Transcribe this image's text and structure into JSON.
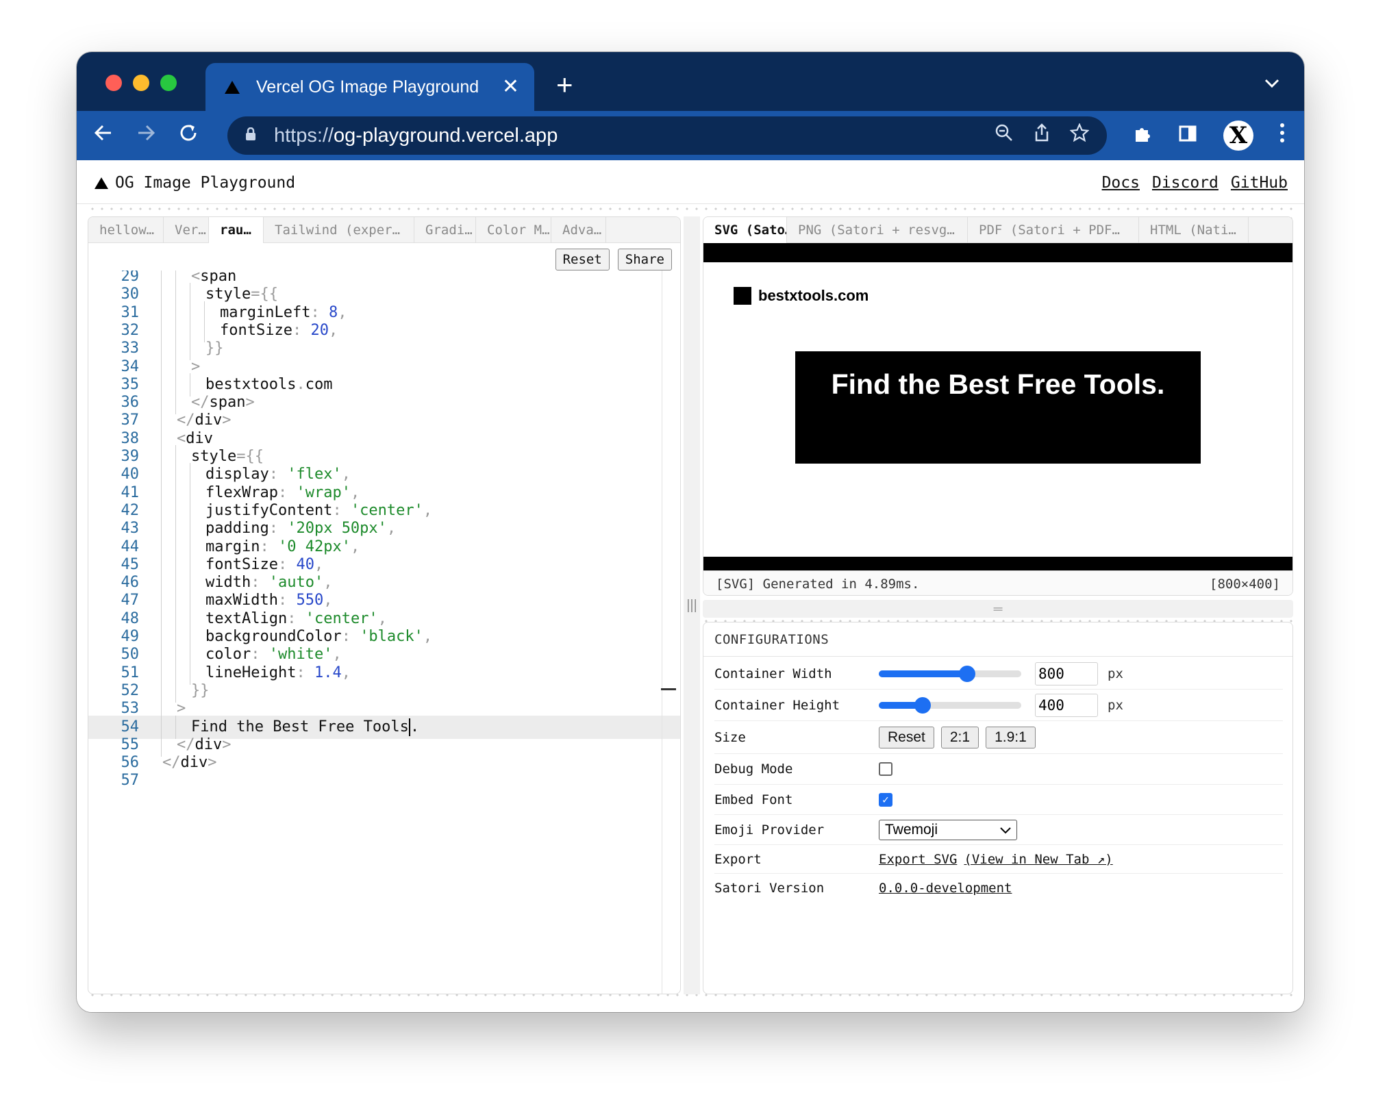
{
  "browser": {
    "tab_title": "Vercel OG Image Playground",
    "tab_close": "✕",
    "new_tab": "+",
    "url_scheme": "https://",
    "url_host": "og-playground.vercel.app",
    "avatar_letter": "X"
  },
  "app": {
    "brand": "OG Image Playground",
    "links": [
      "Docs",
      "Discord",
      "GitHub"
    ]
  },
  "editor": {
    "file_tabs": [
      {
        "label": "hellow…",
        "width": 110
      },
      {
        "label": "Ver…",
        "width": 66
      },
      {
        "label": "rau…",
        "width": 80,
        "active": true
      },
      {
        "label": "Tailwind (exper…",
        "width": 220
      },
      {
        "label": "Gradi…",
        "width": 90
      },
      {
        "label": "Color M…",
        "width": 110
      },
      {
        "label": "Adva…",
        "width": 80
      }
    ],
    "reset_label": "Reset",
    "share_label": "Share",
    "current_line": 54,
    "lines": [
      {
        "n": 29,
        "indent": 2,
        "tokens": [
          [
            "p",
            "<"
          ],
          [
            "t",
            "span"
          ]
        ]
      },
      {
        "n": 30,
        "indent": 3,
        "tokens": [
          [
            "t",
            "style"
          ],
          [
            "p",
            "={{"
          ]
        ]
      },
      {
        "n": 31,
        "indent": 4,
        "tokens": [
          [
            "t",
            "marginLeft"
          ],
          [
            "p",
            ": "
          ],
          [
            "n",
            "8"
          ],
          [
            "p",
            ","
          ]
        ]
      },
      {
        "n": 32,
        "indent": 4,
        "tokens": [
          [
            "t",
            "fontSize"
          ],
          [
            "p",
            ": "
          ],
          [
            "n",
            "20"
          ],
          [
            "p",
            ","
          ]
        ]
      },
      {
        "n": 33,
        "indent": 3,
        "tokens": [
          [
            "p",
            "}}"
          ]
        ]
      },
      {
        "n": 34,
        "indent": 2,
        "tokens": [
          [
            "p",
            ">"
          ]
        ]
      },
      {
        "n": 35,
        "indent": 3,
        "tokens": [
          [
            "t",
            "bestxtools"
          ],
          [
            "p",
            "."
          ],
          [
            "t",
            "com"
          ]
        ]
      },
      {
        "n": 36,
        "indent": 2,
        "tokens": [
          [
            "p",
            "</"
          ],
          [
            "t",
            "span"
          ],
          [
            "p",
            ">"
          ]
        ]
      },
      {
        "n": 37,
        "indent": 1,
        "tokens": [
          [
            "p",
            "</"
          ],
          [
            "t",
            "div"
          ],
          [
            "p",
            ">"
          ]
        ]
      },
      {
        "n": 38,
        "indent": 1,
        "tokens": [
          [
            "p",
            "<"
          ],
          [
            "t",
            "div"
          ]
        ]
      },
      {
        "n": 39,
        "indent": 2,
        "tokens": [
          [
            "t",
            "style"
          ],
          [
            "p",
            "={{"
          ]
        ]
      },
      {
        "n": 40,
        "indent": 3,
        "tokens": [
          [
            "t",
            "display"
          ],
          [
            "p",
            ": "
          ],
          [
            "s",
            "'flex'"
          ],
          [
            "p",
            ","
          ]
        ]
      },
      {
        "n": 41,
        "indent": 3,
        "tokens": [
          [
            "t",
            "flexWrap"
          ],
          [
            "p",
            ": "
          ],
          [
            "s",
            "'wrap'"
          ],
          [
            "p",
            ","
          ]
        ]
      },
      {
        "n": 42,
        "indent": 3,
        "tokens": [
          [
            "t",
            "justifyContent"
          ],
          [
            "p",
            ": "
          ],
          [
            "s",
            "'center'"
          ],
          [
            "p",
            ","
          ]
        ]
      },
      {
        "n": 43,
        "indent": 3,
        "tokens": [
          [
            "t",
            "padding"
          ],
          [
            "p",
            ": "
          ],
          [
            "s",
            "'20px 50px'"
          ],
          [
            "p",
            ","
          ]
        ]
      },
      {
        "n": 44,
        "indent": 3,
        "tokens": [
          [
            "t",
            "margin"
          ],
          [
            "p",
            ": "
          ],
          [
            "s",
            "'0 42px'"
          ],
          [
            "p",
            ","
          ]
        ]
      },
      {
        "n": 45,
        "indent": 3,
        "tokens": [
          [
            "t",
            "fontSize"
          ],
          [
            "p",
            ": "
          ],
          [
            "n",
            "40"
          ],
          [
            "p",
            ","
          ]
        ]
      },
      {
        "n": 46,
        "indent": 3,
        "tokens": [
          [
            "t",
            "width"
          ],
          [
            "p",
            ": "
          ],
          [
            "s",
            "'auto'"
          ],
          [
            "p",
            ","
          ]
        ]
      },
      {
        "n": 47,
        "indent": 3,
        "tokens": [
          [
            "t",
            "maxWidth"
          ],
          [
            "p",
            ": "
          ],
          [
            "n",
            "550"
          ],
          [
            "p",
            ","
          ]
        ]
      },
      {
        "n": 48,
        "indent": 3,
        "tokens": [
          [
            "t",
            "textAlign"
          ],
          [
            "p",
            ": "
          ],
          [
            "s",
            "'center'"
          ],
          [
            "p",
            ","
          ]
        ]
      },
      {
        "n": 49,
        "indent": 3,
        "tokens": [
          [
            "t",
            "backgroundColor"
          ],
          [
            "p",
            ": "
          ],
          [
            "s",
            "'black'"
          ],
          [
            "p",
            ","
          ]
        ]
      },
      {
        "n": 50,
        "indent": 3,
        "tokens": [
          [
            "t",
            "color"
          ],
          [
            "p",
            ": "
          ],
          [
            "s",
            "'white'"
          ],
          [
            "p",
            ","
          ]
        ]
      },
      {
        "n": 51,
        "indent": 3,
        "tokens": [
          [
            "t",
            "lineHeight"
          ],
          [
            "p",
            ": "
          ],
          [
            "n",
            "1.4"
          ],
          [
            "p",
            ","
          ]
        ]
      },
      {
        "n": 52,
        "indent": 2,
        "tokens": [
          [
            "p",
            "}}"
          ]
        ]
      },
      {
        "n": 53,
        "indent": 1,
        "tokens": [
          [
            "p",
            ">"
          ]
        ]
      },
      {
        "n": 54,
        "indent": 2,
        "tokens": [
          [
            "t",
            "Find the Best Free Tools"
          ]
        ],
        "cursor": true,
        "tail": "."
      },
      {
        "n": 55,
        "indent": 1,
        "tokens": [
          [
            "p",
            "</"
          ],
          [
            "t",
            "div"
          ],
          [
            "p",
            ">"
          ]
        ]
      },
      {
        "n": 56,
        "indent": 0,
        "tokens": [
          [
            "p",
            "</"
          ],
          [
            "t",
            "div"
          ],
          [
            "p",
            ">"
          ]
        ]
      },
      {
        "n": 57,
        "indent": 0,
        "tokens": []
      }
    ]
  },
  "preview": {
    "tabs": [
      {
        "label": "SVG (Sato…",
        "width": 122,
        "active": true
      },
      {
        "label": "PNG (Satori + resvg…",
        "width": 264
      },
      {
        "label": "PDF (Satori + PDF…",
        "width": 250
      },
      {
        "label": "HTML (Nati…",
        "width": 160
      }
    ],
    "og_logo_text": "bestxtools.com",
    "og_headline": "Find the Best Free Tools.",
    "status_left": "[SVG] Generated in 4.89ms.",
    "status_right": "[800×400]"
  },
  "config": {
    "title": "CONFIGURATIONS",
    "width_label": "Container Width",
    "width_value": "800",
    "width_fraction": 0.62,
    "height_label": "Container Height",
    "height_value": "400",
    "height_fraction": 0.31,
    "unit": "px",
    "size_label": "Size",
    "size_buttons": [
      "Reset",
      "2:1",
      "1.9:1"
    ],
    "debug_label": "Debug Mode",
    "debug_checked": false,
    "font_label": "Embed Font",
    "font_checked": true,
    "emoji_label": "Emoji Provider",
    "emoji_value": "Twemoji",
    "export_label": "Export",
    "export_svg": "Export SVG",
    "export_newtab": "(View in New Tab ↗)",
    "version_label": "Satori Version",
    "version_value": "0.0.0-development"
  }
}
